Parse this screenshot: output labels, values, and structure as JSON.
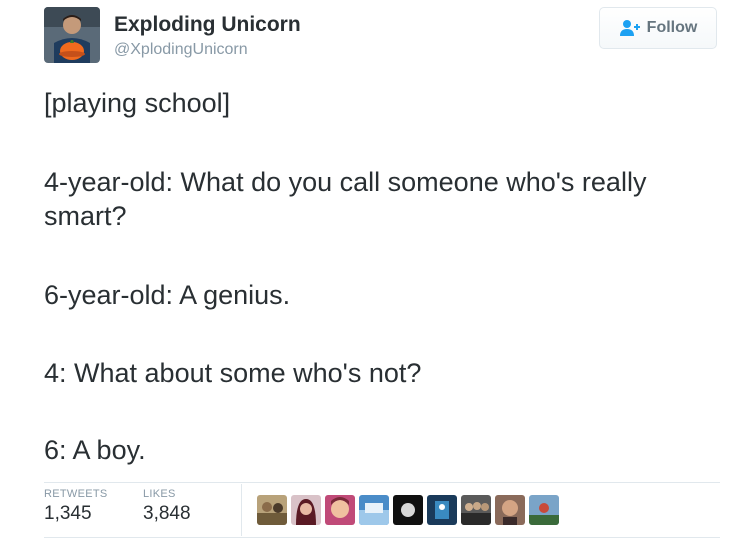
{
  "tweet": {
    "author_name": "Exploding Unicorn",
    "author_handle": "@XplodingUnicorn",
    "follow_label": "Follow",
    "paragraphs": [
      "[playing school]",
      "4-year-old: What do you call someone who's really smart?",
      "6-year-old: A genius.",
      "4: What about some who's not?",
      "6: A boy."
    ]
  },
  "stats": {
    "retweets_label": "RETWEETS",
    "retweets_value": "1,345",
    "likes_label": "LIKES",
    "likes_value": "3,848"
  },
  "colors": {
    "text": "#292f33",
    "muted": "#8899a6",
    "border": "#e1e8ed",
    "follow_icon": "#1da1f2"
  },
  "icons": {
    "follow": "follow-user-icon"
  }
}
